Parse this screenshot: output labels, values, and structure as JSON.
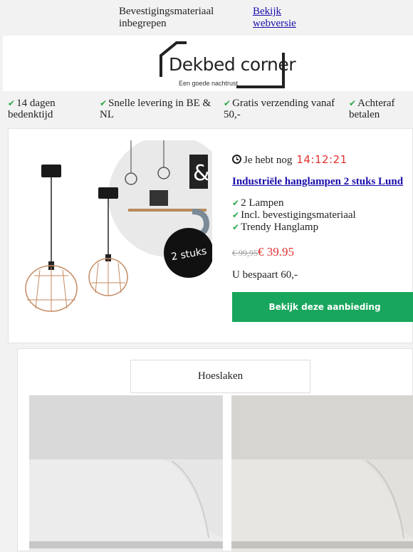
{
  "topbar": {
    "preheader": "Bevestigingsmateriaal inbegrepen",
    "web_version_link": "Bekijk webversie"
  },
  "logo": {
    "brand": "Dekbed corner",
    "tagline": "Een goede nachtrust"
  },
  "usps": [
    {
      "icon": "check-icon",
      "label": "14 dagen bedenktijd"
    },
    {
      "icon": "check-icon",
      "label": "Snelle levering in BE & NL"
    },
    {
      "icon": "check-icon",
      "label": "Gratis verzending vanaf 50,-"
    },
    {
      "icon": "check-icon",
      "label": "Achteraf betalen"
    }
  ],
  "offer": {
    "timer_prefix": "Je hebt nog",
    "timer": "14:12:21",
    "badge": "2 stuks",
    "title": "Industriële hanglampen 2 stuks Lund",
    "features": [
      "2 Lampen",
      "Incl. bevestigingsmateriaal",
      "Trendy Hanglamp"
    ],
    "old_price": "€ 99,95",
    "new_price": "€ 39.95",
    "saving": "U bespaart 60,-",
    "cta": "Bekijk deze aanbieding"
  },
  "category": {
    "label": "Hoeslaken"
  },
  "colors": {
    "accent_green": "#18a65c",
    "price_red": "#e03131",
    "link_blue": "#1a0dab"
  }
}
